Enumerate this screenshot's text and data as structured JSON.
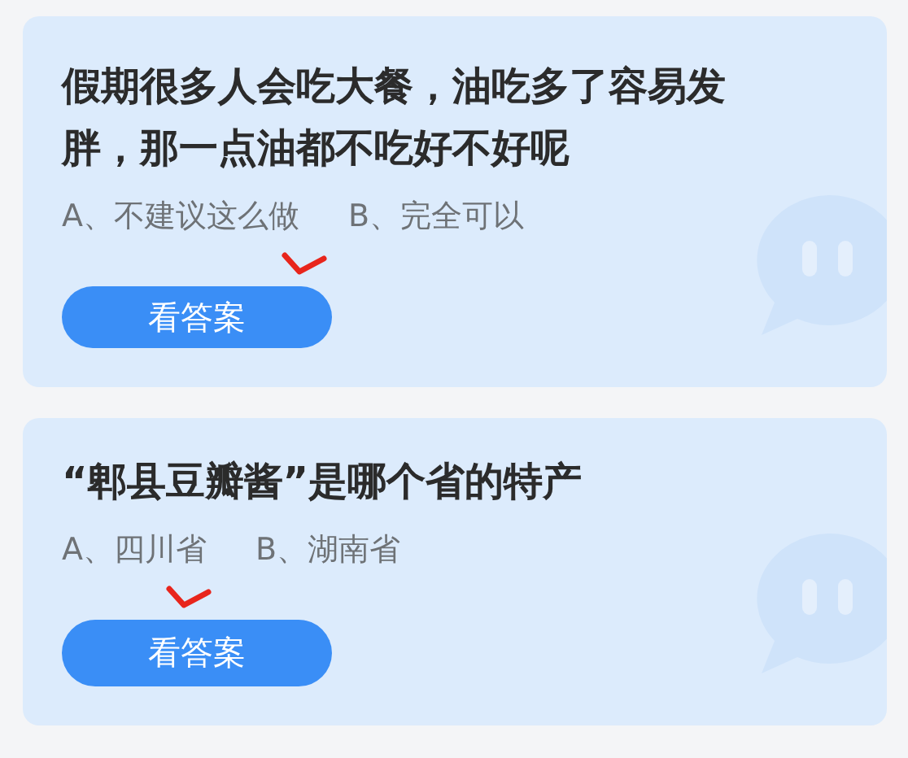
{
  "cards": [
    {
      "question": "假期很多人会吃大餐，油吃多了容易发胖，那一点油都不吃好不好呢",
      "options": [
        {
          "text": "A、不建议这么做",
          "checked": true
        },
        {
          "text": "B、完全可以",
          "checked": false
        }
      ],
      "button": "看答案"
    },
    {
      "question": "“郫县豆瓣酱”是哪个省的特产",
      "options": [
        {
          "text": "A、四川省",
          "checked": true
        },
        {
          "text": "B、湖南省",
          "checked": false
        }
      ],
      "button": "看答案"
    }
  ]
}
